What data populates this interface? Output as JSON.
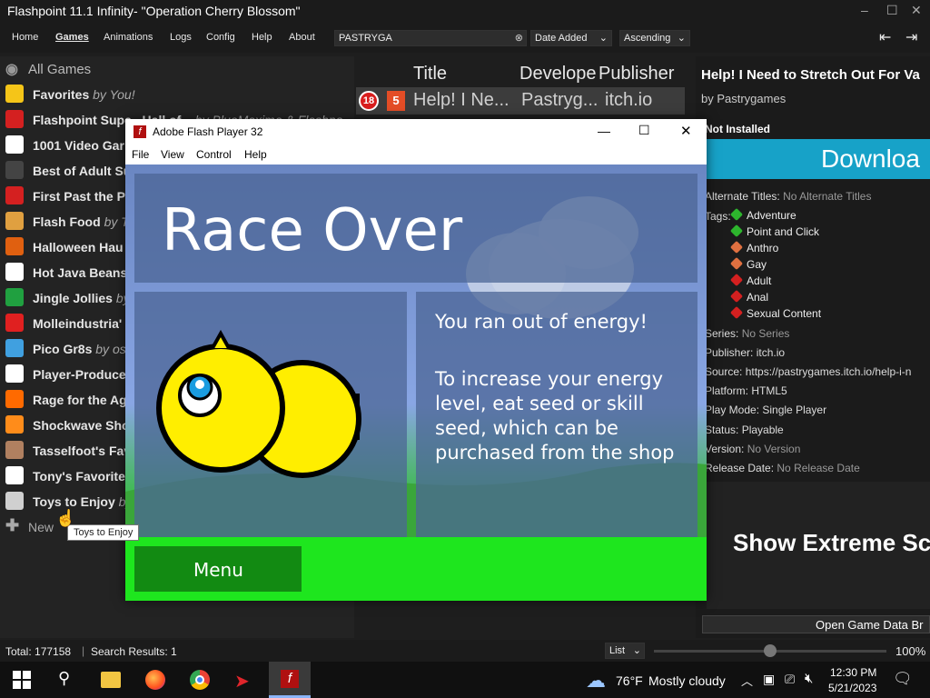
{
  "window": {
    "title": "Flashpoint 11.1 Infinity- \"Operation Cherry Blossom\""
  },
  "menubar": {
    "items": [
      "Home",
      "Games",
      "Animations",
      "Logs",
      "Config",
      "Help",
      "About"
    ],
    "search_value": "PASTRYGA",
    "sort_by": "Date Added",
    "order": "Ascending"
  },
  "sidebar": {
    "all_games": "All Games",
    "new_label": "New",
    "playlists": [
      {
        "name": "Favorites",
        "by": "by You!",
        "color": "#f5c518"
      },
      {
        "name": "Flashpoint Supe...Hall of...",
        "by": "by BlueMaxima & Flashpo...",
        "color": "#d42020"
      },
      {
        "name": "1001 Video Gar",
        "by": "",
        "color": "#ffffff"
      },
      {
        "name": "Best of Adult Su",
        "by": "",
        "color": "#444444"
      },
      {
        "name": "First Past the Po",
        "by": "",
        "color": "#d42020"
      },
      {
        "name": "Flash Food",
        "by": "by Th",
        "color": "#e0a040"
      },
      {
        "name": "Halloween Hau",
        "by": "",
        "color": "#e06010"
      },
      {
        "name": "Hot Java Beans",
        "by": "",
        "color": "#ffffff"
      },
      {
        "name": "Jingle Jollies",
        "by": "by",
        "color": "#20a040"
      },
      {
        "name": "Molleindustria'",
        "by": "",
        "color": "#e02020"
      },
      {
        "name": "Pico Gr8s",
        "by": "by osh",
        "color": "#40a0e0"
      },
      {
        "name": "Player-Produce",
        "by": "",
        "color": "#ffffff"
      },
      {
        "name": "Rage for the Ag",
        "by": "",
        "color": "#ff6a00"
      },
      {
        "name": "Shockwave Sho",
        "by": "",
        "color": "#ff8c1a"
      },
      {
        "name": "Tasselfoot's Fav",
        "by": "",
        "color": "#b08060"
      },
      {
        "name": "Tony's Favorite",
        "by": "",
        "color": "#ffffff"
      },
      {
        "name": "Toys to Enjoy",
        "by": "by",
        "color": "#d0d0d0"
      }
    ]
  },
  "tooltip": "Toys to Enjoy",
  "center": {
    "columns": [
      "Title",
      "Develope",
      "Publisher"
    ],
    "row": {
      "age": "18",
      "title": "Help! I Ne...",
      "developer": "Pastryg...",
      "publisher": "itch.io"
    }
  },
  "right": {
    "title": "Help! I Need to Stretch Out For Va",
    "by": "by Pastrygames",
    "install_status": "Not Installed",
    "download_label": "Downloa",
    "alt_titles_label": "Alternate Titles:",
    "alt_titles_value": "No Alternate Titles",
    "tags_label": "Tags:",
    "tags": [
      {
        "name": "Adventure",
        "color": "#2db52d"
      },
      {
        "name": "Point and Click",
        "color": "#2db52d"
      },
      {
        "name": "Anthro",
        "color": "#e07040"
      },
      {
        "name": "Gay",
        "color": "#e07040"
      },
      {
        "name": "Adult",
        "color": "#d42020"
      },
      {
        "name": "Anal",
        "color": "#d42020"
      },
      {
        "name": "Sexual Content",
        "color": "#d42020"
      }
    ],
    "series_label": "Series:",
    "series_value": "No Series",
    "publisher_label": "Publisher:",
    "publisher_value": "itch.io",
    "source_label": "Source:",
    "source_value": "https://pastrygames.itch.io/help-i-n",
    "platform_label": "Platform:",
    "platform_value": "HTML5",
    "playmode_label": "Play Mode:",
    "playmode_value": "Single Player",
    "status_label": "Status:",
    "status_value": "Playable",
    "version_label": "Version:",
    "version_value": "No Version",
    "release_label": "Release Date:",
    "release_value": "No Release Date",
    "extreme_label": "Show Extreme Sc",
    "open_data_label": "Open Game Data Br"
  },
  "statusbar": {
    "total": "Total: 177158",
    "results": "Search Results: 1",
    "view_mode": "List",
    "zoom": "100%",
    "zoom_level": 0.5
  },
  "flash": {
    "title": "Adobe Flash Player 32",
    "menu": [
      "File",
      "View",
      "Control",
      "Help"
    ],
    "heading": "Race Over",
    "message1": "You ran out of energy!",
    "message2": "To increase your energy level, eat seed or skill seed, which can be purchased from the shop",
    "menu_button": "Menu"
  },
  "taskbar": {
    "weather_temp": "76°F",
    "weather_text": "Mostly cloudy",
    "time": "12:30 PM",
    "date": "5/21/2023"
  }
}
